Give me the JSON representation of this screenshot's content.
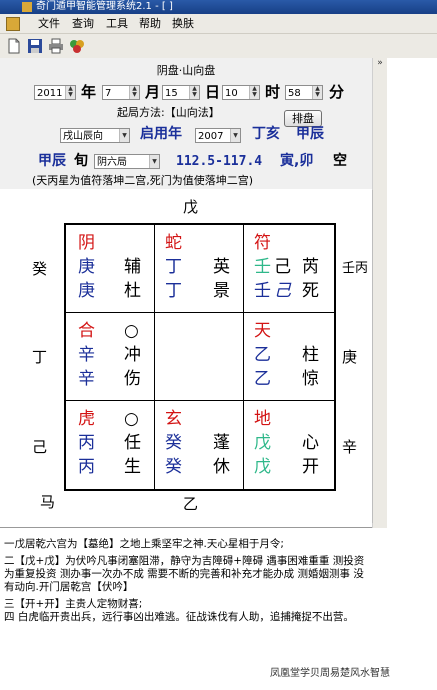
{
  "window": {
    "title": "奇门遁甲智能管理系统2.1 - [ ]"
  },
  "menu": [
    {
      "label": "文件"
    },
    {
      "label": "查询"
    },
    {
      "label": "工具"
    },
    {
      "label": "帮助"
    },
    {
      "label": "换肤"
    }
  ],
  "toolbar": {
    "icons": [
      "document-icon",
      "save-icon",
      "print-icon",
      "gems-icon"
    ]
  },
  "panel": {
    "title": "阴盘·山向盘",
    "date": {
      "year": "2011",
      "year_unit": "年",
      "month": "7",
      "month_unit": "月",
      "day": "15",
      "day_unit": "日",
      "hour": "10",
      "hour_unit": "时",
      "minute": "58",
      "minute_unit": "分"
    },
    "method_label": "起局方法:【山向法】",
    "arrange_button": "排盘",
    "direction_select": "戌山辰向",
    "start_year_label": "启用年",
    "start_year_value": "2007",
    "gz1": "丁亥",
    "gz2": "甲辰",
    "xun": "甲辰",
    "xun_unit": "旬",
    "ju_select": "阴六局",
    "degrees": "112.5-117.4",
    "shan": "寅,卯",
    "kong": "空",
    "info": "(天丙星为值符落坤二宫,死门为值使落坤二宫)"
  },
  "board": {
    "outer": {
      "top": "戊",
      "bottom": "乙",
      "left_top": "癸",
      "left_mid": "丁",
      "left_bot": "己",
      "right_top": "壬丙",
      "right_mid": "庚",
      "right_bot": "辛",
      "horse": "马"
    },
    "cells": [
      {
        "spirit": "阴",
        "stem1": "庚",
        "star": "辅",
        "stem2": "庚",
        "door": "杜"
      },
      {
        "spirit": "蛇",
        "stem1": "丁",
        "star": "英",
        "stem2": "丁",
        "door": "景"
      },
      {
        "spirit": "符",
        "stem1": "壬",
        "stem1b": "己",
        "star": "芮",
        "stem2": "壬",
        "stem2b": "己",
        "door": "死"
      },
      {
        "spirit": "合",
        "stem1": "辛",
        "star": "冲",
        "stem2": "辛",
        "door": "伤",
        "circle": "○"
      },
      {},
      {
        "spirit": "天",
        "stem1": "乙",
        "star": "柱",
        "stem2": "乙",
        "door": "惊"
      },
      {
        "spirit": "虎",
        "stem1": "丙",
        "star": "任",
        "stem2": "丙",
        "door": "生",
        "circle": "○"
      },
      {
        "spirit": "玄",
        "stem1": "癸",
        "star": "蓬",
        "stem2": "癸",
        "door": "休"
      },
      {
        "spirit": "地",
        "stem1": "戊",
        "star": "心",
        "stem2": "戊",
        "door": "开"
      }
    ]
  },
  "analysis": {
    "line1": "一戊居乾六宫为【墓绝】之地上乘坚牢之神.天心星相于月令;",
    "line2": "二【戊+戊】为伏吟凡事闭塞阻滞，静守为吉障碍+障碍 遇事困难重重 测投资 为重复投资 测办事一次办不成 需要不断的完善和补充才能办成 测婚姻测事 没有动向.开门居乾宫【伏吟】",
    "line3": "三【开+开】主贵人定物财喜;",
    "line4": "四 白虎临开贵出兵，远行事凶出难逃。征战诛伐有人助，追捕掩捉不出营。"
  },
  "watermark": "凤凰堂学贝周易楚风水智慧"
}
